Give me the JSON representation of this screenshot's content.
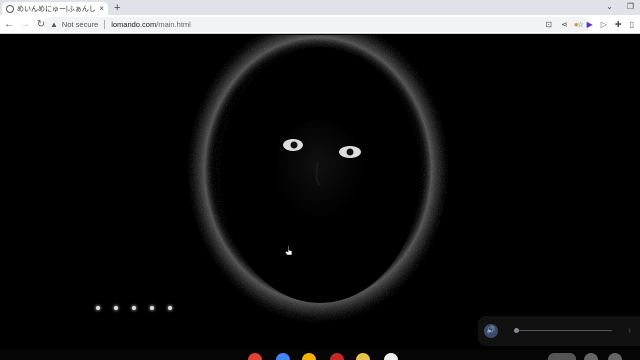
{
  "browser": {
    "tab_title": "めいんめにゅー|ふぁんし…",
    "tab_close": "×",
    "newtab": "+",
    "security_label": "Not secure",
    "url_domain": "lomando.com",
    "url_path": "/main.html"
  },
  "page": {
    "carousel_dot_count": 5,
    "volume_level": 0.0
  },
  "colors": {
    "page_background": "#000000",
    "tab_strip": "#dfe3e8",
    "volume_button": "#3c4a6b"
  }
}
